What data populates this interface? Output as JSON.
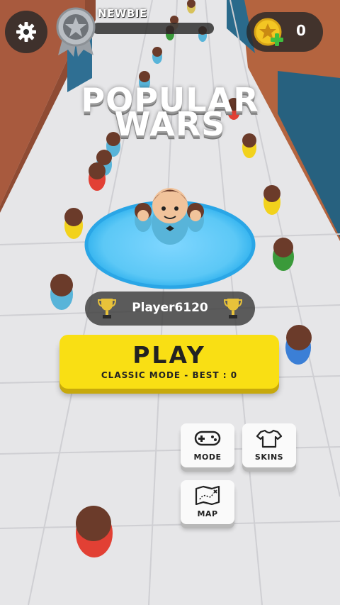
{
  "hud": {
    "settings_icon": "gear-icon",
    "rank_badge_icon": "star-medal-icon",
    "rank_label": "NEWBIE",
    "rank_progress": 0,
    "coin_icon": "star-coin-plus-icon",
    "coins": "0"
  },
  "title": {
    "line1": "POPULAR",
    "line2": "WARS"
  },
  "player": {
    "name": "Player6120",
    "left_icon": "trophy-icon",
    "right_icon": "trophy-icon"
  },
  "play_button": {
    "label": "PLAY",
    "subtitle": "CLASSIC MODE - BEST : 0"
  },
  "menu": {
    "mode": {
      "label": "MODE",
      "icon": "gamepad-icon"
    },
    "skins": {
      "label": "SKINS",
      "icon": "tshirt-icon"
    },
    "map": {
      "label": "MAP",
      "icon": "treasure-map-icon"
    }
  },
  "colors": {
    "play_yellow": "#f9df14",
    "selection_ring": "#4fc3f7",
    "coin_gold": "#f3c623",
    "plus_green": "#3fbf3f"
  }
}
